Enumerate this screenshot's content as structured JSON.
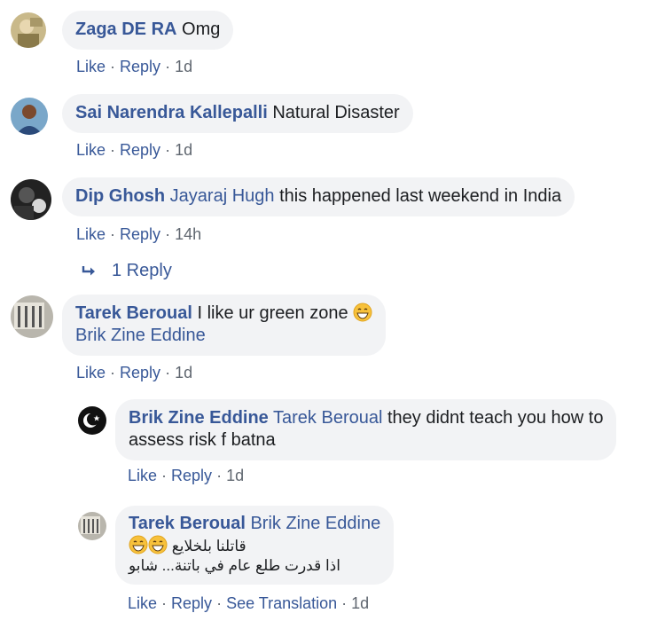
{
  "actions": {
    "like": "Like",
    "reply": "Reply",
    "see_translation": "See Translation",
    "separator": "·"
  },
  "comments": [
    {
      "author": "Zaga DE RA",
      "text": "Omg",
      "time": "1d"
    },
    {
      "author": "Sai Narendra Kallepalli",
      "text": "Natural Disaster",
      "time": "1d"
    },
    {
      "author": "Dip Ghosh",
      "mention": "Jayaraj Hugh",
      "text": "this happened last weekend in India",
      "time": "14h"
    },
    {
      "author": "Tarek Beroual",
      "text": "I like ur green zone",
      "mention": "Brik Zine Eddine",
      "time": "1d"
    }
  ],
  "replies_link": {
    "label": "1 Reply",
    "icon": "reply-arrow-icon"
  },
  "replies": [
    {
      "author": "Brik Zine Eddine",
      "mention": "Tarek Beroual",
      "line1": "they didnt teach you how to",
      "line2": "assess risk f batna",
      "time": "1d"
    },
    {
      "author": "Tarek Beroual",
      "mention": "Brik Zine Eddine",
      "line1": "قاتلنا بلخلايع",
      "line2": "اذا قدرت طلع عام في باتنة... شابو",
      "time": "1d"
    }
  ],
  "colors": {
    "link": "#385898",
    "bubble": "#f2f3f5",
    "meta": "#606770"
  }
}
